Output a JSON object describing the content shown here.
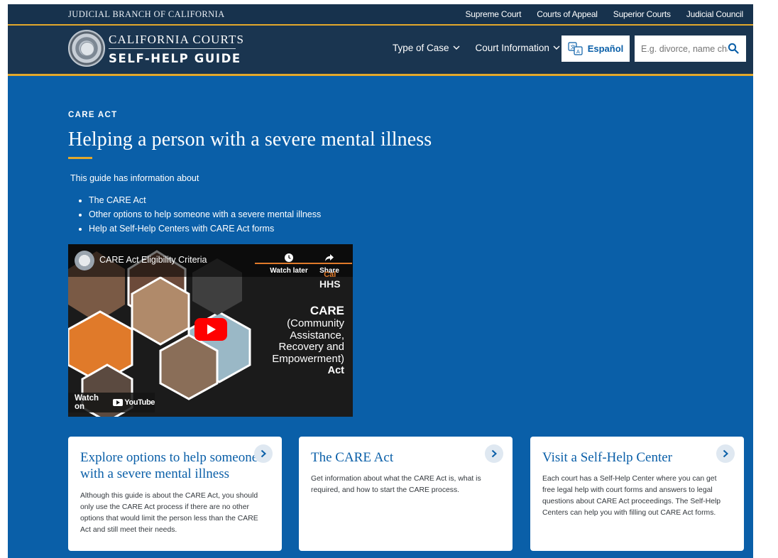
{
  "utility": {
    "brand": "JUDICIAL BRANCH OF CALIFORNIA",
    "links": [
      "Supreme Court",
      "Courts of Appeal",
      "Superior Courts",
      "Judicial Council"
    ]
  },
  "header": {
    "logo_top": "CALIFORNIA COURTS",
    "logo_bottom": "SELF-HELP GUIDE",
    "seal_icon": "california-seal",
    "nav": [
      "Type of Case",
      "Court Information"
    ],
    "espanol_label": "Español",
    "search_placeholder": "E.g. divorce, name change"
  },
  "hero": {
    "eyebrow": "CARE ACT",
    "title": "Helping a person with a severe mental illness",
    "intro": "This guide has information about",
    "bullets": [
      "The CARE Act",
      "Other options to help someone with a severe mental illness",
      "Help at Self-Help Centers with CARE Act forms"
    ]
  },
  "video": {
    "title": "CARE Act Eligibility Criteria",
    "watch_later": "Watch later",
    "share": "Share",
    "hhs_top": "Cal",
    "hhs_bottom": "HHS",
    "care_heading": "CARE",
    "care_lines": "(Community\nAssistance,\nRecovery and\nEmpowerment)",
    "care_act": "Act",
    "watch_on": "Watch on",
    "youtube": "YouTube"
  },
  "cards": [
    {
      "title": "Explore options to help someone with a severe mental illness",
      "body": "Although this guide is about the CARE Act, you should only use the CARE Act process if there are no other options that would limit the person less than the CARE Act and still meet their needs."
    },
    {
      "title": "The CARE Act",
      "body": "Get information about what the CARE Act is, what is required, and how to start the CARE process."
    },
    {
      "title": "Visit a Self-Help Center",
      "body": "Each court has a Self-Help Center where you can get free legal help with court forms and answers to legal questions about CARE Act proceedings. The Self-Help Centers can help you with filling out CARE Act forms."
    }
  ],
  "colors": {
    "page_blue": "#0a5fa8",
    "header_navy": "#1a3550",
    "accent_gold": "#e3a82b",
    "card_arrow_bg": "#dfe8f1"
  }
}
